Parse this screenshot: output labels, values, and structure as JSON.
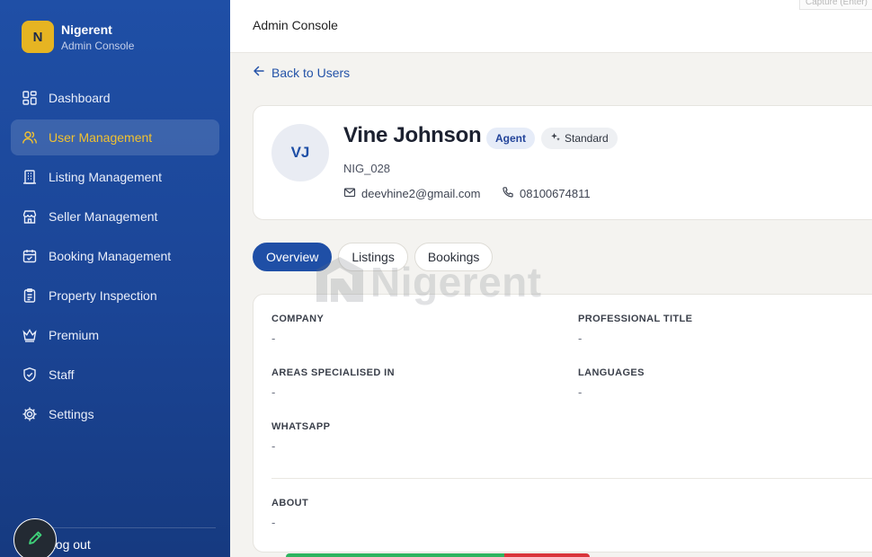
{
  "brand": {
    "initial": "N",
    "name": "Nigerent",
    "subtitle": "Admin Console"
  },
  "sidebar": {
    "items": [
      {
        "label": "Dashboard",
        "icon": "dashboard-icon",
        "active": false
      },
      {
        "label": "User Management",
        "icon": "users-icon",
        "active": true
      },
      {
        "label": "Listing Management",
        "icon": "building-icon",
        "active": false
      },
      {
        "label": "Seller Management",
        "icon": "store-icon",
        "active": false
      },
      {
        "label": "Booking Management",
        "icon": "calendar-icon",
        "active": false
      },
      {
        "label": "Property Inspection",
        "icon": "clipboard-icon",
        "active": false
      },
      {
        "label": "Premium",
        "icon": "crown-icon",
        "active": false
      },
      {
        "label": "Staff",
        "icon": "shield-icon",
        "active": false
      },
      {
        "label": "Settings",
        "icon": "gear-icon",
        "active": false
      }
    ],
    "logout_label": "Log out"
  },
  "header": {
    "title": "Admin Console",
    "capture_hint": "Capture (Enter)"
  },
  "back_link": {
    "label": "Back to Users"
  },
  "profile": {
    "initials": "VJ",
    "name": "Vine Johnson",
    "role_badge": "Agent",
    "tier_badge": "Standard",
    "user_id": "NIG_028",
    "email": "deevhine2@gmail.com",
    "phone": "08100674811"
  },
  "tabs": [
    {
      "label": "Overview",
      "active": true
    },
    {
      "label": "Listings",
      "active": false
    },
    {
      "label": "Bookings",
      "active": false
    }
  ],
  "details": {
    "company": {
      "label": "COMPANY",
      "value": "-"
    },
    "professional_title": {
      "label": "PROFESSIONAL TITLE",
      "value": "-"
    },
    "areas": {
      "label": "AREAS SPECIALISED IN",
      "value": "-"
    },
    "languages": {
      "label": "LANGUAGES",
      "value": "-"
    },
    "whatsapp": {
      "label": "WHATSAPP",
      "value": "-"
    },
    "about": {
      "label": "ABOUT",
      "value": "-"
    }
  },
  "watermark": {
    "text": "Nigerent"
  },
  "colors": {
    "primary": "#1f4fa6",
    "accent": "#f2c230",
    "brand_logo": "#e6b422",
    "success": "#2fb460",
    "danger": "#d9343b"
  }
}
